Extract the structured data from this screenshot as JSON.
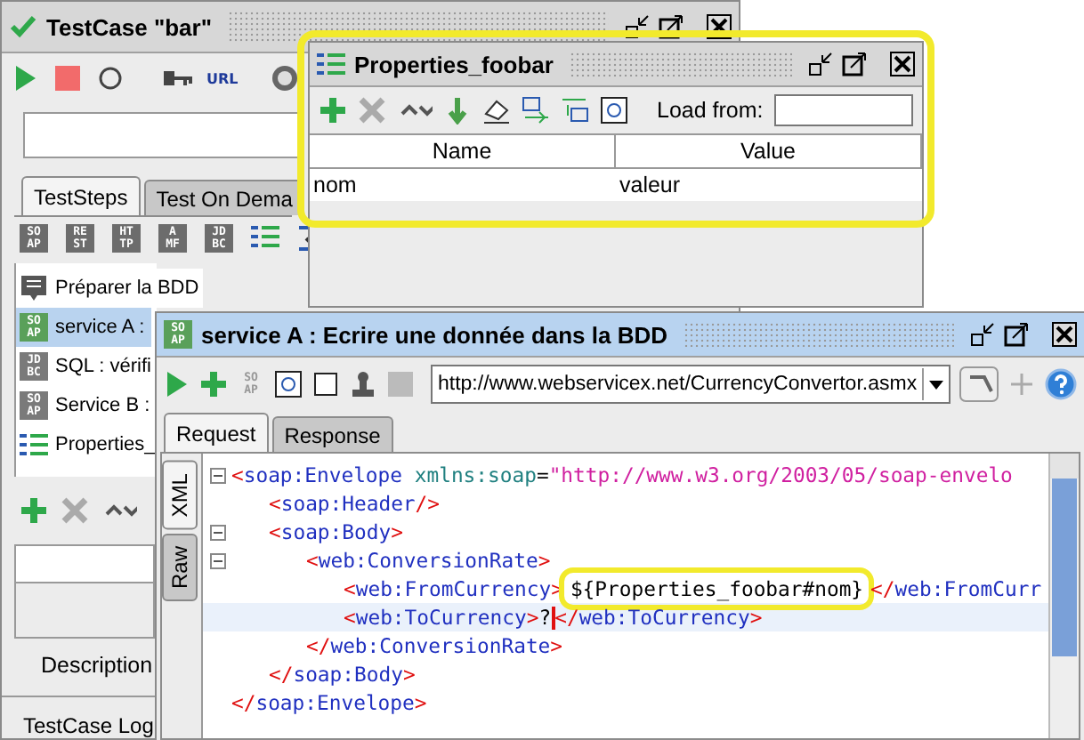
{
  "testcase_window": {
    "title": "TestCase \"bar\"",
    "url_label": "URL",
    "tabs": [
      {
        "label": "TestSteps",
        "selected": true
      },
      {
        "label": "Test On Dema",
        "selected": false
      }
    ],
    "step_type_buttons": [
      [
        "SO",
        "AP"
      ],
      [
        "RE",
        "ST"
      ],
      [
        "HT",
        "TP"
      ],
      [
        "A",
        "MF"
      ],
      [
        "JD",
        "BC"
      ]
    ],
    "steps": [
      {
        "kind": "note",
        "label": "Préparer la BDD",
        "selected": false
      },
      {
        "kind": "badge",
        "badge": [
          "SO",
          "AP"
        ],
        "color": "#5aa05a",
        "label": "service A :",
        "selected": true
      },
      {
        "kind": "badge",
        "badge": [
          "JD",
          "BC"
        ],
        "color": "#7a7a7a",
        "label": "SQL : vérifi",
        "selected": false
      },
      {
        "kind": "badge",
        "badge": [
          "SO",
          "AP"
        ],
        "color": "#7a7a7a",
        "label": "Service B :",
        "selected": false
      },
      {
        "kind": "properties",
        "label": "Properties_",
        "selected": false
      }
    ],
    "description_label": "Description",
    "log_label": "TestCase Log"
  },
  "properties_window": {
    "title": "Properties_foobar",
    "highlighted": true,
    "load_from_label": "Load from:",
    "columns": [
      "Name",
      "Value"
    ],
    "rows": [
      {
        "name": "nom",
        "value": "valeur"
      }
    ]
  },
  "request_window": {
    "title": "service A : Ecrire une donnée dans la BDD",
    "badge": [
      "SO",
      "AP"
    ],
    "toolbar_badge": [
      "SO",
      "AP"
    ],
    "url": "http://www.webservicex.net/CurrencyConvertor.asmx",
    "tabs": [
      {
        "label": "Request",
        "selected": true
      },
      {
        "label": "Response",
        "selected": false
      }
    ],
    "side_tabs": [
      {
        "label": "XML",
        "selected": true
      },
      {
        "label": "Raw",
        "selected": false
      }
    ],
    "xml": [
      {
        "open": [
          {
            "kind": "punct",
            "text": "<"
          },
          {
            "kind": "name",
            "text": "soap:Envelope "
          },
          {
            "kind": "attr",
            "text": "xmlns:soap"
          },
          {
            "kind": "text",
            "text": "="
          },
          {
            "kind": "value",
            "text": "\"http://www.w3.org/2003/05/soap-envelo"
          }
        ],
        "children": [
          {
            "open": [
              {
                "kind": "punct",
                "text": "<"
              },
              {
                "kind": "name",
                "text": "soap:Header"
              },
              {
                "kind": "punct",
                "text": "/>"
              }
            ]
          },
          {
            "open": [
              {
                "kind": "punct",
                "text": "<"
              },
              {
                "kind": "name",
                "text": "soap:Body"
              },
              {
                "kind": "punct",
                "text": ">"
              }
            ],
            "children": [
              {
                "open": [
                  {
                    "kind": "punct",
                    "text": "<"
                  },
                  {
                    "kind": "name",
                    "text": "web:ConversionRate"
                  },
                  {
                    "kind": "punct",
                    "text": ">"
                  }
                ],
                "children": [
                  {
                    "current": false,
                    "open": [
                      {
                        "kind": "punct",
                        "text": "<"
                      },
                      {
                        "kind": "name",
                        "text": "web:FromCurrency"
                      },
                      {
                        "kind": "punct",
                        "text": ">"
                      },
                      {
                        "kind": "text",
                        "text": "${Properties_foobar#nom}",
                        "highlighted": true
                      },
                      {
                        "kind": "punct",
                        "text": "</"
                      },
                      {
                        "kind": "name",
                        "text": "web:FromCurr"
                      }
                    ]
                  },
                  {
                    "current": true,
                    "open": [
                      {
                        "kind": "punct",
                        "text": "<"
                      },
                      {
                        "kind": "name",
                        "text": "web:ToCurrency"
                      },
                      {
                        "kind": "punct",
                        "text": ">"
                      },
                      {
                        "kind": "text",
                        "text": "?"
                      },
                      {
                        "kind": "punct",
                        "text": "</"
                      },
                      {
                        "kind": "name",
                        "text": "web:ToCurrency"
                      },
                      {
                        "kind": "punct",
                        "text": ">"
                      }
                    ]
                  }
                ],
                "close": [
                  {
                    "kind": "punct",
                    "text": "</"
                  },
                  {
                    "kind": "name",
                    "text": "web:ConversionRate"
                  },
                  {
                    "kind": "punct",
                    "text": ">"
                  }
                ]
              }
            ],
            "close": [
              {
                "kind": "punct",
                "text": "</"
              },
              {
                "kind": "name",
                "text": "soap:Body"
              },
              {
                "kind": "punct",
                "text": ">"
              }
            ]
          }
        ],
        "close": [
          {
            "kind": "punct",
            "text": "</"
          },
          {
            "kind": "name",
            "text": "soap:Envelope"
          },
          {
            "kind": "punct",
            "text": ">"
          }
        ]
      }
    ]
  }
}
